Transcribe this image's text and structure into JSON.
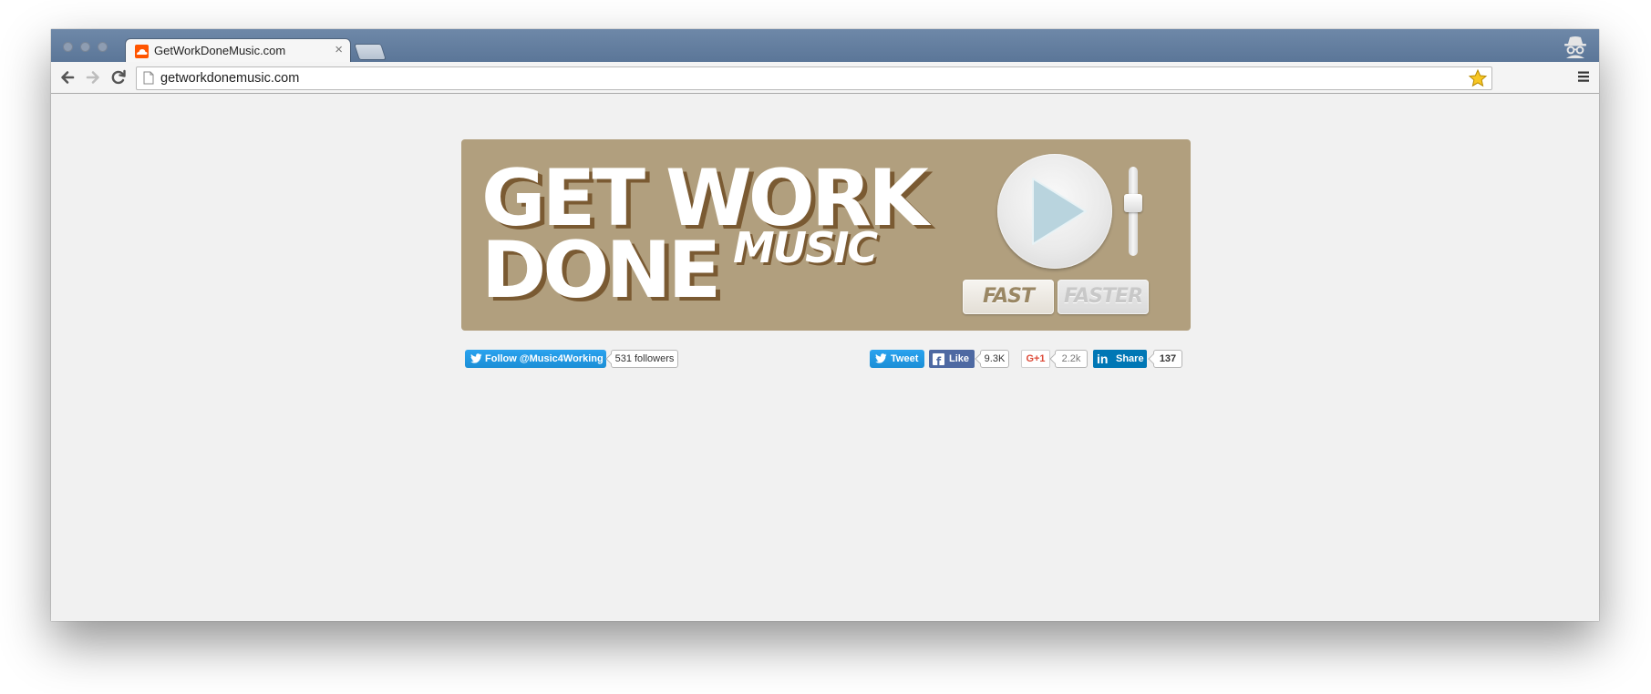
{
  "browser": {
    "tab_title": "GetWorkDoneMusic.com",
    "tab_close": "×",
    "url": "getworkdonemusic.com"
  },
  "banner": {
    "logo_line1": "GET WORK",
    "logo_line2": "DONE",
    "logo_music": "MUSIC",
    "fast_label": "FAST",
    "faster_label": "FASTER",
    "bg_color": "#b19f7e"
  },
  "social": {
    "twitter_follow_label": "Follow @Music4Working",
    "twitter_followers": "531 followers",
    "tweet_label": "Tweet",
    "fb_like_label": "Like",
    "fb_like_count": "9.3K",
    "gplus_label": "G+1",
    "gplus_count": "2.2k",
    "linkedin_label": "Share",
    "linkedin_icon": "in",
    "linkedin_count": "137"
  },
  "icons": {
    "favicon": "soundcloud-icon",
    "play": "play-icon",
    "incognito": "incognito-icon"
  },
  "colors": {
    "twitter_blue": "#1b8fd6",
    "facebook_blue": "#4e69a2",
    "linkedin_blue": "#0077b5",
    "gplus_red": "#dd4b39"
  }
}
